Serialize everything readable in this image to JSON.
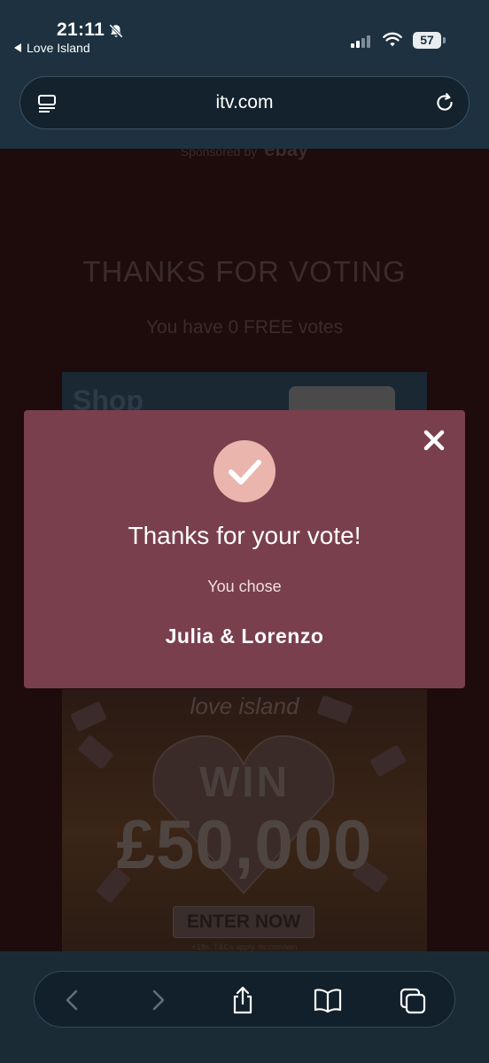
{
  "status_bar": {
    "time": "21:11",
    "back_app": "Love Island",
    "battery": "57"
  },
  "browser": {
    "url": "itv.com"
  },
  "page": {
    "sponsor_prefix": "Sponsored by",
    "sponsor_brand": "ebay",
    "title": "THANKS FOR VOTING",
    "free_votes": "You have 0 FREE votes",
    "ad_top": {
      "text": "Shop"
    },
    "ad_bottom": {
      "logo": "love island",
      "headline": "WIN",
      "amount": "£50,000",
      "cta": "ENTER NOW",
      "terms": "+18s. T&Cs apply. itv.com/win"
    }
  },
  "modal": {
    "title": "Thanks for your vote!",
    "subtitle": "You chose",
    "choice": "Julia & Lorenzo"
  },
  "colors": {
    "modal_bg": "#793f4d",
    "check_circle": "#e9b5ad",
    "browser_chrome": "#1d3140"
  },
  "icons": [
    "bell-slash-icon",
    "cellular-signal-icon",
    "wifi-icon",
    "battery-icon",
    "reader-mode-icon",
    "reload-icon",
    "close-icon",
    "checkmark-icon",
    "back-arrow-icon",
    "forward-arrow-icon",
    "share-icon",
    "bookmarks-icon",
    "tabs-icon"
  ]
}
